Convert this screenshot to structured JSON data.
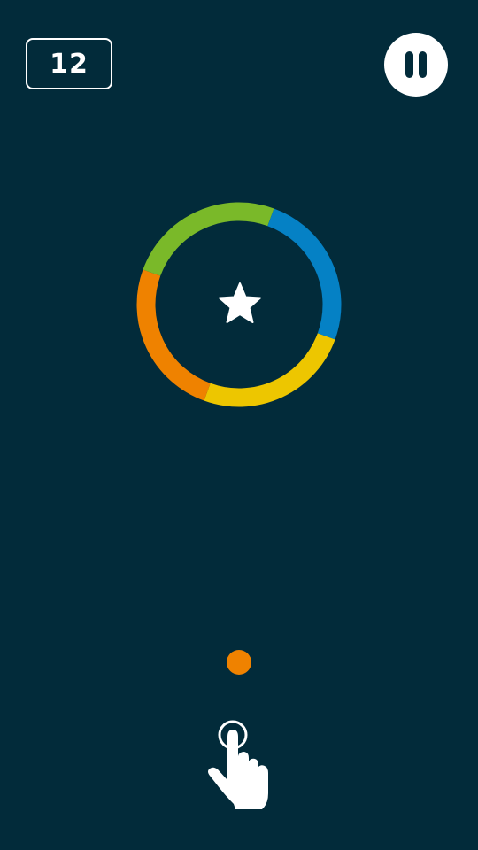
{
  "game": {
    "score": "12"
  },
  "colors": {
    "background": "#022b3a",
    "ring_green": "#7ab929",
    "ring_blue": "#0581c5",
    "ring_yellow": "#edc600",
    "ring_orange": "#ef8200",
    "ball": "#ef8200",
    "white": "#ffffff"
  },
  "icons": {
    "pause": "pause-icon",
    "star": "star-icon",
    "tap_hint": "tap-hand-icon"
  }
}
